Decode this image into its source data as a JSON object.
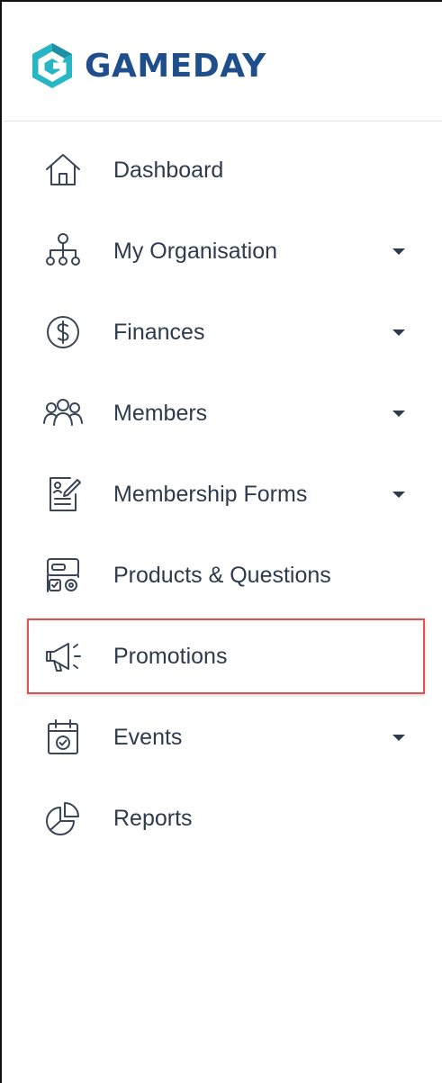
{
  "brand": {
    "name": "GAMEDAY",
    "logo_icon": "gameday-logo-icon",
    "colors": {
      "text": "#1f4e8c",
      "mark_primary": "#27b6c4",
      "mark_secondary": "#1d8fa6"
    }
  },
  "sidebar": {
    "items": [
      {
        "label": "Dashboard",
        "icon": "home-icon",
        "has_submenu": false
      },
      {
        "label": "My Organisation",
        "icon": "org-chart-icon",
        "has_submenu": true
      },
      {
        "label": "Finances",
        "icon": "dollar-icon",
        "has_submenu": true
      },
      {
        "label": "Members",
        "icon": "members-icon",
        "has_submenu": true
      },
      {
        "label": "Membership Forms",
        "icon": "form-icon",
        "has_submenu": true
      },
      {
        "label": "Products & Questions",
        "icon": "products-icon",
        "has_submenu": false
      },
      {
        "label": "Promotions",
        "icon": "megaphone-icon",
        "has_submenu": false,
        "highlighted": true
      },
      {
        "label": "Events",
        "icon": "calendar-icon",
        "has_submenu": true
      },
      {
        "label": "Reports",
        "icon": "pie-chart-icon",
        "has_submenu": false
      }
    ]
  },
  "colors": {
    "text": "#2f3b4c",
    "icon": "#3a4656",
    "highlight_border": "#e05252",
    "divider": "#dde2e8"
  }
}
